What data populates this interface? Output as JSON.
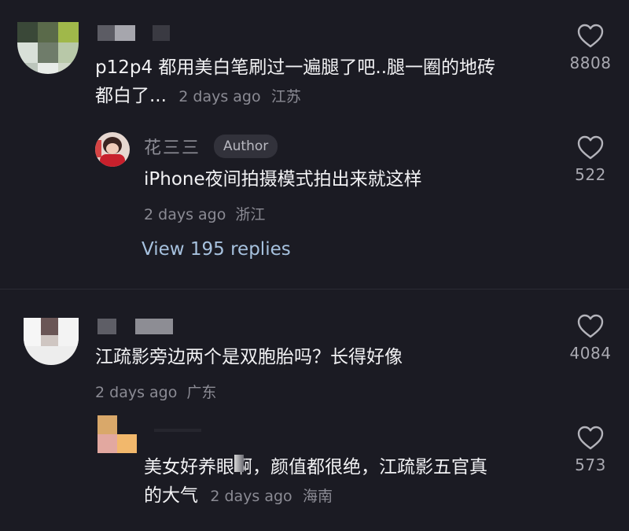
{
  "comments": [
    {
      "text": "p12p4 都用美白笔刷过一遍腿了吧..腿一圈的地砖都白了...",
      "text_line1": "p12p4 都用美白笔刷过一遍腿了吧..腿一圈的地砖",
      "text_line2": "都白了...",
      "time": "2 days ago",
      "location": "江苏",
      "likes": "8808",
      "username_censored": true,
      "reply": {
        "username": "花三三",
        "badge": "Author",
        "text": "iPhone夜间拍摄模式拍出来就这样",
        "time": "2 days ago",
        "location": "浙江",
        "likes": "522"
      },
      "view_replies": "View 195 replies"
    },
    {
      "text": "江疏影旁边两个是双胞胎吗？长得好像",
      "time": "2 days ago",
      "location": "广东",
      "likes": "4084",
      "username_censored": true,
      "reply": {
        "text_line1": "美女好养眼啊，颜值都很绝，江疏影五官真",
        "text_line2": "的大气",
        "time": "2 days ago",
        "location": "海南",
        "likes": "573"
      }
    }
  ],
  "colors": {
    "background": "#1b1b23",
    "text": "#f2f2f4",
    "meta": "#8b8b94",
    "link": "#a7c2df",
    "badge_bg": "#32323b"
  },
  "icons": {
    "like": "heart-outline-icon"
  }
}
